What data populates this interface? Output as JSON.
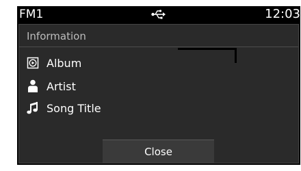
{
  "status_bar": {
    "source": "FM1",
    "usb_icon": "usb-icon",
    "time": "12:03"
  },
  "info_panel": {
    "title": "Information",
    "rows": [
      {
        "icon": "album-icon",
        "label": "Album"
      },
      {
        "icon": "artist-icon",
        "label": "Artist"
      },
      {
        "icon": "music-note-icon",
        "label": "Song Title"
      }
    ],
    "close_label": "Close"
  },
  "colors": {
    "background": "#000000",
    "panel": "#2a2a2a",
    "text": "#ffffff",
    "title_text": "#bdbdbd",
    "button": "#3a3a3a"
  }
}
